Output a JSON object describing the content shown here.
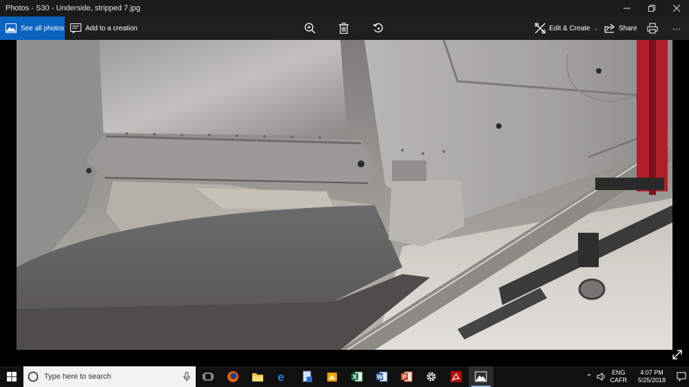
{
  "window": {
    "title": "Photos - S30 - Underside, stripped 7.jpg",
    "controls": [
      "minimize",
      "maximize",
      "close"
    ]
  },
  "toolbar": {
    "see_all_label": "See all photos",
    "add_creation_label": "Add to a creation",
    "edit_create_label": "Edit & Create",
    "share_label": "Share",
    "more_label": "···"
  },
  "search": {
    "placeholder": "Type here to search"
  },
  "tray": {
    "lang_top": "ENG",
    "lang_bottom": "CAFR",
    "time": "4:07 PM",
    "date": "5/25/2018"
  },
  "colors": {
    "accent": "#0b64c0",
    "titlebar": "#1b1b1b",
    "toolbar": "#1f1f1f",
    "taskbar": "#101010"
  }
}
